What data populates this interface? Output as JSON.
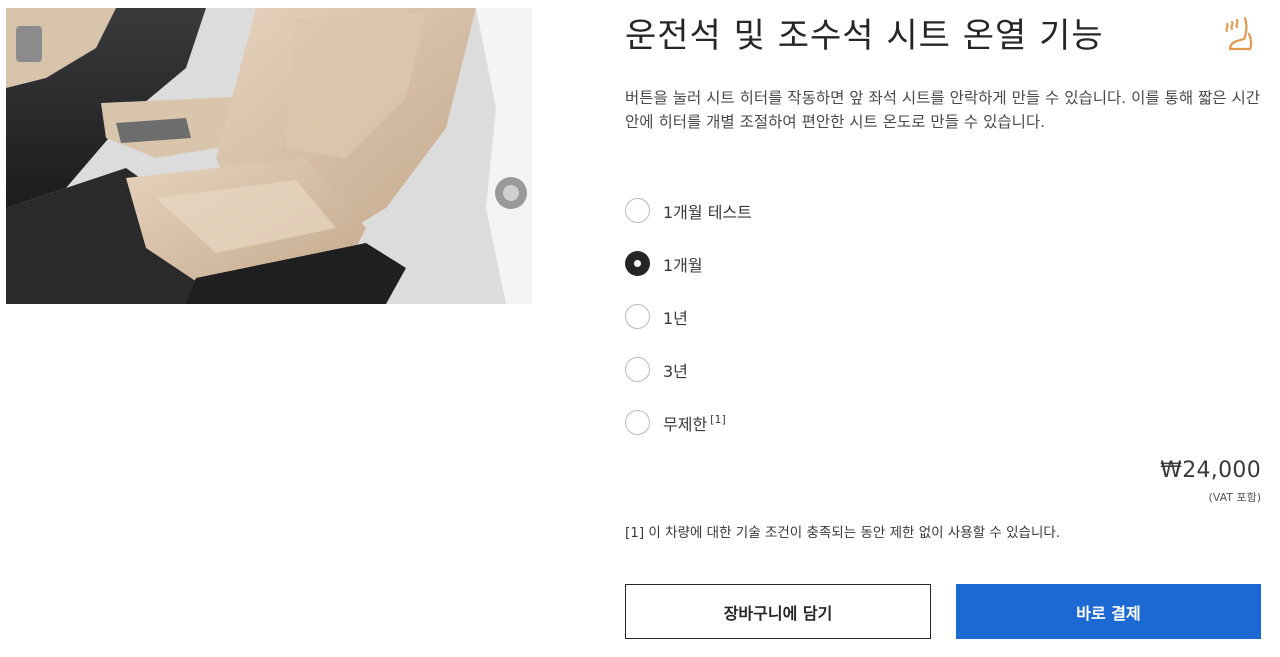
{
  "product": {
    "title": "운전석 및 조수석 시트 온열 기능",
    "icon": "seat-heating-icon",
    "accent_color": "#e29b4e",
    "description": "버튼을 눌러 시트 히터를 작동하면 앞 좌석 시트를 안락하게 만들 수 있습니다. 이를 통해 짧은 시간 안에 히터를 개별 조절하여 편안한 시트 온도로 만들 수 있습니다."
  },
  "options": [
    {
      "label": "1개월 테스트",
      "selected": false
    },
    {
      "label": "1개월",
      "selected": true
    },
    {
      "label": "1년",
      "selected": false
    },
    {
      "label": "3년",
      "selected": false
    },
    {
      "label": "무제한",
      "selected": false,
      "footnote": "[1]"
    }
  ],
  "pricing": {
    "price": "₩24,000",
    "vat_note": "(VAT 포함)"
  },
  "footnote_text": "[1] 이 차량에 대한 기술 조건이 충족되는 동안 제한 없이 사용할 수 있습니다.",
  "actions": {
    "cart_label": "장바구니에 담기",
    "buy_label": "바로 결제",
    "buy_color": "#1c69d4"
  }
}
